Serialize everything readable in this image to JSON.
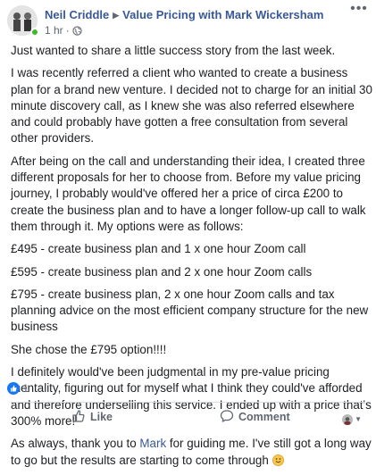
{
  "post": {
    "author": "Neil Criddle",
    "group": "Value Pricing with Mark Wickersham",
    "time": "1 hr",
    "separator": "·",
    "more_label": "•••",
    "paragraphs": [
      {
        "text": "Just wanted to share a little success story from the last week."
      },
      {
        "text": "I was recently referred a client who wanted to create a business plan for a brand new venture. I decided not to charge for an initial 30 minute discovery call, as I knew she was also referred elsewhere and could probably have gotten a free consultation from several other providers."
      },
      {
        "text": "After being on the call and understanding their idea, I created three different proposals for her to choose from. Before my value pricing journey, I probably would've offered her a price of circa £200 to create the business plan and to have a longer follow-up call to walk them through it. My options were as follows:"
      },
      {
        "text": "£495 - create business plan and 1 x one hour Zoom call"
      },
      {
        "text": "£595 - create business plan and 2 x one hour Zoom calls"
      },
      {
        "text": "£795 - create business plan, 2 x one hour Zoom calls and tax planning advice on the most efficient company structure for the new business"
      },
      {
        "text": "She chose the £795 option!!!!"
      },
      {
        "text": "I definitely would've been judgmental in my pre-value pricing mentality, figuring out for myself what I think they could've afforded and therefore underselling this service. I ended up with a price that's 300% more!"
      }
    ],
    "last_paragraph": {
      "before": "As always, thank you to ",
      "mention": "Mark",
      "after": " for guiding me. I've still got a long way to go but the results are starting to come through "
    }
  },
  "reactions": {
    "count": "1"
  },
  "actions": {
    "like": "Like",
    "comment": "Comment"
  },
  "colors": {
    "link": "#385898",
    "like_blue": "#1877f2",
    "online": "#42b72a",
    "muted": "#606770"
  },
  "icons": [
    "globe-icon",
    "like-icon",
    "comment-icon",
    "more-icon",
    "smile-emoji-icon",
    "caret-down-icon"
  ]
}
